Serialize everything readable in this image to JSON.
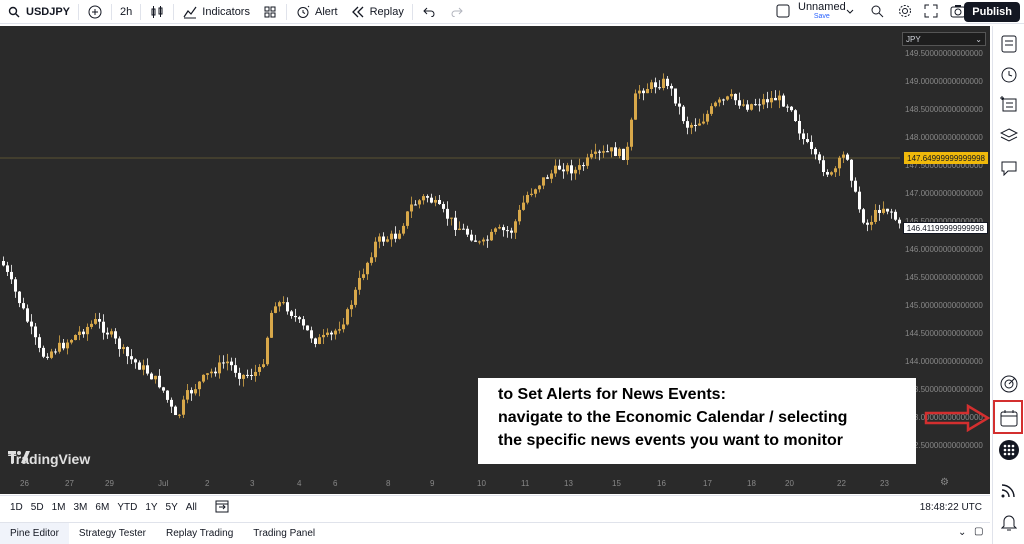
{
  "toolbar": {
    "symbol": "USDJPY",
    "interval": "2h",
    "indicators": "Indicators",
    "alert": "Alert",
    "replay": "Replay",
    "layout_name": "Unnamed",
    "layout_status": "Save",
    "publish": "Publish"
  },
  "chart": {
    "currency": "JPY",
    "price_labels": [
      "149.50000000000000",
      "149.00000000000000",
      "148.50000000000000",
      "148.00000000000000",
      "147.50000000000000",
      "147.00000000000000",
      "146.50000000000000",
      "146.00000000000000",
      "145.50000000000000",
      "145.00000000000000",
      "144.50000000000000",
      "144.00000000000000",
      "143.50000000000000",
      "143.00000000000000",
      "142.50000000000000"
    ],
    "badge_prev": "147.64999999999998",
    "badge_last": "146.41199999999998",
    "date_labels": [
      "26",
      "27",
      "29",
      "Jul",
      "2",
      "3",
      "4",
      "6",
      "8",
      "9",
      "10",
      "11",
      "13",
      "15",
      "16",
      "17",
      "18",
      "20",
      "22",
      "23"
    ],
    "watermark": "TradingView",
    "colors": {
      "up": "#d8a84a",
      "down": "#ffffff",
      "background": "#2a2a2a"
    }
  },
  "annotation": {
    "line1": "to Set Alerts for News Events:",
    "line2": "navigate to the Economic Calendar / selecting",
    "line3": "the specific news events you want to monitor"
  },
  "timebar": {
    "ranges": [
      "1D",
      "5D",
      "1M",
      "3M",
      "6M",
      "YTD",
      "1Y",
      "5Y",
      "All"
    ],
    "clock": "18:48:22 UTC"
  },
  "panels": [
    "Pine Editor",
    "Strategy Tester",
    "Replay Trading",
    "Trading Panel"
  ]
}
